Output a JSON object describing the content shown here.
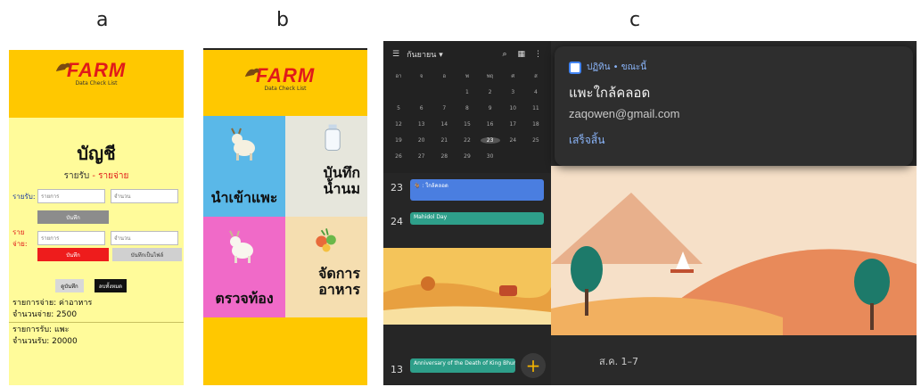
{
  "labels": {
    "a": "a",
    "b": "b",
    "c": "c"
  },
  "logo": {
    "name": "FARM",
    "subtitle": "Data Check List",
    "caption": "แพะใกล้คลอด"
  },
  "panel_a": {
    "title": "บัญชี",
    "subtitle_income": "รายรับ",
    "subtitle_sep": " - ",
    "subtitle_expense": "รายจ่าย",
    "income_label": "รายรับ:",
    "income_item_placeholder": "รายการ",
    "income_amount_placeholder": "จำนวน",
    "save_income_label": "บันทึก",
    "expense_label": "รายจ่าย:",
    "expense_item_placeholder": "รายการ",
    "expense_amount_placeholder": "จำนวน",
    "save_expense_label": "บันทึก",
    "save_file_label": "บันทึกเป็นไฟล์",
    "view_label": "ดูบันทึก",
    "delete_all_label": "ลบทั้งหมด",
    "expense_item_text": "รายการจ่าย: ค่าอาหาร",
    "expense_amount_text": "จำนวนจ่าย: 2500",
    "income_item_text": "รายการรับ: แพะ",
    "income_amount_text": "จำนวนรับ: 20000"
  },
  "panel_b": {
    "tiles": [
      {
        "label": "นำเข้าแพะ",
        "color": "#5ab8e8"
      },
      {
        "label_line1": "บันทึก",
        "label_line2": "น้ำนม",
        "color": "#e6e6dc"
      },
      {
        "label": "ตรวจท้อง",
        "color": "#f06ac8"
      },
      {
        "label_line1": "จัดการ",
        "label_line2": "อาหาร",
        "color": "#f5deb0"
      }
    ]
  },
  "panel_c": {
    "month": "กันยายน ▾",
    "weekday_letters": [
      "อา",
      "จ",
      "อ",
      "พ",
      "พฤ",
      "ศ",
      "ส"
    ],
    "weeks": [
      [
        "",
        "",
        "",
        "1",
        "2",
        "3",
        "4"
      ],
      [
        "5",
        "6",
        "7",
        "8",
        "9",
        "10",
        "11"
      ],
      [
        "12",
        "13",
        "14",
        "15",
        "16",
        "17",
        "18"
      ],
      [
        "19",
        "20",
        "21",
        "22",
        "23",
        "24",
        "25"
      ],
      [
        "26",
        "27",
        "28",
        "29",
        "30",
        "",
        ""
      ]
    ],
    "today": "23",
    "day_23": "23",
    "day_24": "24",
    "day_13": "13",
    "event_23_text": "🐐 : ใกล้คลอด",
    "event_24_text": "Mahidol Day",
    "event_13_text": "Anniversary of the Death of King Bhumibol",
    "fab_symbol": "+",
    "notification": {
      "app": "ปฏิทิน • ขณะนี้",
      "title": "แพะใกล้คลอด",
      "email": "zaqowen@gmail.com",
      "action": "เสร็จสิ้น"
    },
    "week_label_1": "ส.ค. 1–7",
    "colors": {
      "event_23": "#4a7ee0",
      "event_24": "#2e9f8a",
      "accent": "#8ab4f8"
    }
  }
}
